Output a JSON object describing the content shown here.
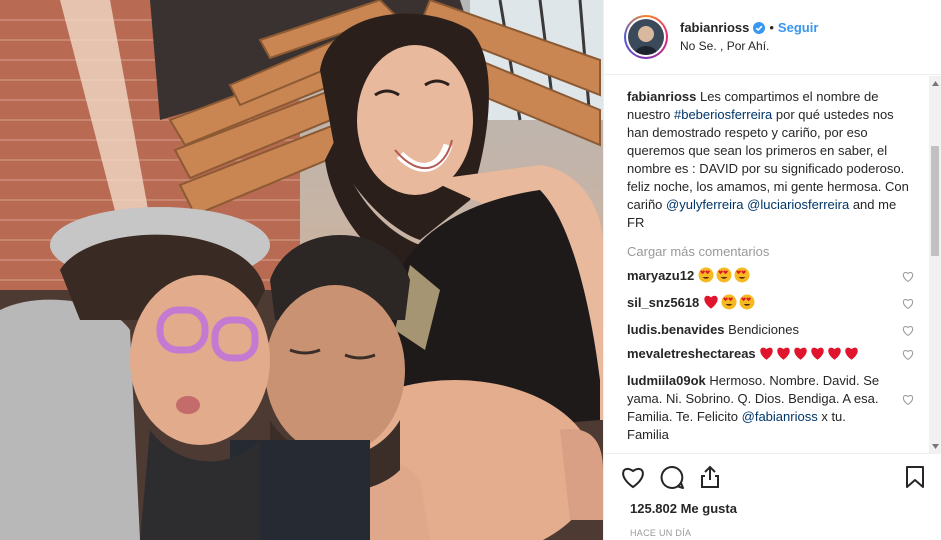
{
  "colors": {
    "link": "#003569",
    "follow": "#3897f0",
    "verified": "#3897f0",
    "heart_emoji": "#e0142c",
    "muted": "#999999"
  },
  "post": {
    "photo_alt": "family-selfie-photo"
  },
  "header": {
    "username": "fabianrioss",
    "separator": "•",
    "follow_label": "Seguir",
    "location": "No Se. , Por Ahí.",
    "verified_icon": "verified-badge-icon"
  },
  "caption": {
    "username": "fabianrioss",
    "text_1": " Les compartimos el nombre de nuestro ",
    "hashtag": "#beberiosferreira",
    "text_2": " por qué ustedes nos han demostrado respeto y cariño, por eso queremos que sean los primeros en saber, el nombre es : DAVID por su significado poderoso. feliz noche, los amamos, mi gente hermosa. Con cariño ",
    "mention_1": "@yulyferreira",
    "mention_2": "@luciariosferreira",
    "text_3": " and me FR"
  },
  "load_more": "Cargar más comentarios",
  "comments": [
    {
      "username": "maryazu12",
      "text": "",
      "emojis": [
        "heart-eyes-emoji",
        "heart-eyes-emoji",
        "heart-eyes-emoji"
      ]
    },
    {
      "username": "sil_snz5618",
      "text": "",
      "emojis": [
        "red-heart-emoji",
        "heart-eyes-emoji",
        "heart-eyes-emoji"
      ]
    },
    {
      "username": "ludis.benavides",
      "text": "Bendiciones",
      "emojis": []
    },
    {
      "username": "mevaletreshectareas",
      "text": "",
      "emojis": [
        "red-heart-emoji",
        "red-heart-emoji",
        "red-heart-emoji",
        "red-heart-emoji",
        "red-heart-emoji",
        "red-heart-emoji"
      ]
    },
    {
      "username": "ludmiila09ok",
      "text": "Hermoso. Nombre. David. Se yama. Ni. Sobrino. Q. Dios. Bendiga. A esa. Familia. Te. Felicito ",
      "mention": "@fabianrioss",
      "text_after": " x tu. Familia"
    }
  ],
  "actions": {
    "like_icon": "heart-outline-icon",
    "comment_icon": "speech-bubble-icon",
    "share_icon": "share-upload-icon",
    "save_icon": "bookmark-icon"
  },
  "likes": "125.802 Me gusta",
  "timestamp": "HACE UN DÍA"
}
